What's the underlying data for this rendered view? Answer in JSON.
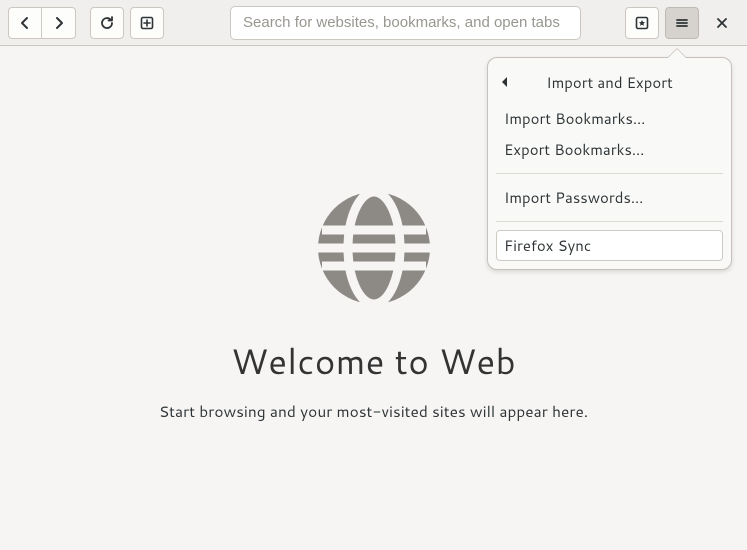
{
  "toolbar": {
    "search_placeholder": "Search for websites, bookmarks, and open tabs"
  },
  "welcome": {
    "title": "Welcome to Web",
    "subtitle": "Start browsing and your most-visited sites will appear here."
  },
  "popover": {
    "title": "Import and Export",
    "items": {
      "import_bookmarks": "Import Bookmarks…",
      "export_bookmarks": "Export Bookmarks…",
      "import_passwords": "Import Passwords…",
      "firefox_sync": "Firefox Sync"
    }
  }
}
